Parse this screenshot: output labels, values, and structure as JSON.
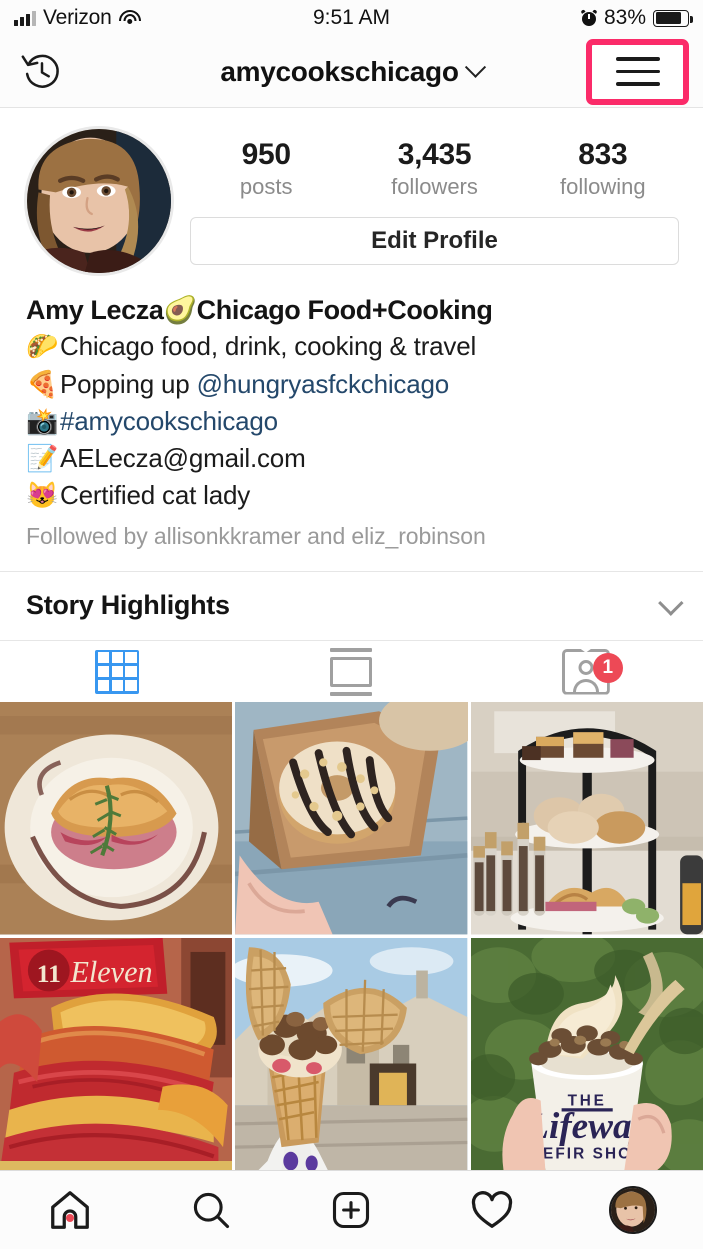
{
  "status_bar": {
    "carrier": "Verizon",
    "signal_icon": "cellular-bars-icon",
    "wifi_icon": "wifi-icon",
    "time": "9:51 AM",
    "alarm_icon": "alarm-clock-icon",
    "battery_percent": "83%",
    "battery_level": 83,
    "battery_icon": "battery-icon"
  },
  "nav": {
    "history_icon": "clock-history-icon",
    "username": "amycookschicago",
    "dropdown_icon": "chevron-down-icon",
    "menu_icon": "hamburger-menu-icon",
    "menu_highlight_color": "#fb2b69"
  },
  "profile": {
    "avatar_icon": "profile-avatar",
    "stats": [
      {
        "num": "950",
        "label": "posts"
      },
      {
        "num": "3,435",
        "label": "followers"
      },
      {
        "num": "833",
        "label": "following"
      }
    ],
    "edit_profile_label": "Edit Profile",
    "bio": {
      "display_name": "Amy Lecza🥑Chicago Food+Cooking",
      "lines": [
        {
          "emoji": "🌮",
          "text": "Chicago food, drink, cooking & travel",
          "link": ""
        },
        {
          "emoji": "🍕",
          "text": "Popping up ",
          "link": "@hungryasfckchicago"
        },
        {
          "emoji": "📸",
          "text": "",
          "link": "#amycookschicago"
        },
        {
          "emoji": "📝",
          "text": "AELecza@gmail.com",
          "link": ""
        },
        {
          "emoji": "😻",
          "text": "Certified cat lady",
          "link": ""
        }
      ],
      "link_color": "#24486b",
      "followed_by": "Followed by allisonkkramer and eliz_robinson"
    }
  },
  "story_highlights": {
    "title": "Story Highlights",
    "chevron_icon": "chevron-down-icon"
  },
  "tabs": [
    {
      "name": "grid-view",
      "icon": "grid-icon",
      "active": true,
      "color": "#3897f0",
      "badge": ""
    },
    {
      "name": "list-view",
      "icon": "list-view-icon",
      "active": false,
      "color": "#a0a0a0",
      "badge": ""
    },
    {
      "name": "tagged-photos",
      "icon": "tagged-person-icon",
      "active": false,
      "color": "#a0a0a0",
      "badge": "1"
    }
  ],
  "grid_posts": [
    {
      "id": "post-1",
      "alt": "Croissant sandwich with prosciutto and rosemary on a ceramic plate with balsamic drizzle"
    },
    {
      "id": "post-2",
      "alt": "Two glazed donuts in a brown paper box held in hand"
    },
    {
      "id": "post-3",
      "alt": "Three-tier afternoon tea stand with pastries, scones and tea sample tubes"
    },
    {
      "id": "post-4",
      "alt": "Tall corned beef sandwich in front of a red Eleven sign"
    },
    {
      "id": "post-5",
      "alt": "Gelato cone with waffle wings held up against a stone village street"
    },
    {
      "id": "post-6",
      "alt": "The Lifeway Kefir Shop cup of soft serve topped with chocolate chunks"
    }
  ],
  "bottom_nav": [
    {
      "name": "home",
      "icon": "home-icon",
      "badge_dot": true
    },
    {
      "name": "search",
      "icon": "search-icon",
      "badge_dot": false
    },
    {
      "name": "create",
      "icon": "plus-square-icon",
      "badge_dot": false
    },
    {
      "name": "activity",
      "icon": "heart-icon",
      "badge_dot": false
    },
    {
      "name": "profile",
      "icon": "profile-avatar-icon",
      "badge_dot": false
    }
  ]
}
